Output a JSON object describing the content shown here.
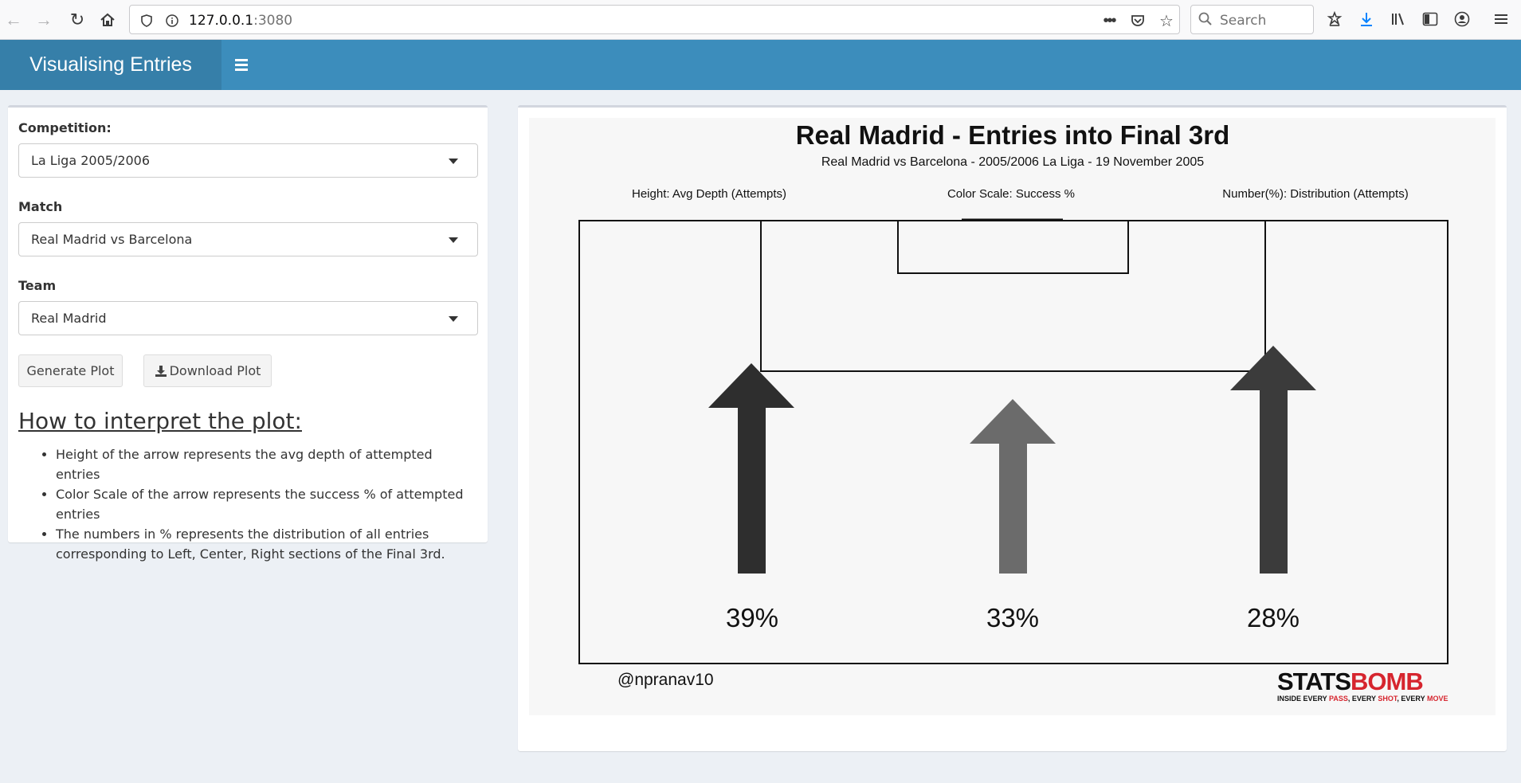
{
  "browser": {
    "url_host": "127.0.0.1",
    "url_port": ":3080",
    "search_placeholder": "Search"
  },
  "header": {
    "title": "Visualising Entries"
  },
  "sidebar": {
    "competition_label": "Competition:",
    "competition_value": "La Liga 2005/2006",
    "match_label": "Match",
    "match_value": "Real Madrid vs Barcelona",
    "team_label": "Team",
    "team_value": "Real Madrid",
    "generate_label": "Generate Plot",
    "download_label": "Download Plot",
    "interp_title": "How to interpret the plot:",
    "interp_items": [
      "Height of the arrow represents the avg depth of attempted entries",
      "Color Scale of the arrow represents the success % of attempted entries",
      "The numbers in % represents the distribution of all entries corresponding to Left, Center, Right sections of the Final 3rd."
    ]
  },
  "plot": {
    "title": "Real Madrid - Entries into Final 3rd",
    "subtitle": "Real Madrid vs Barcelona  -  2005/2006 La Liga  -  19 November 2005",
    "legend_height": "Height: Avg Depth (Attempts)",
    "legend_color": "Color Scale: Success %",
    "legend_number": "Number(%): Distribution (Attempts)",
    "credit": "@npranav10",
    "logo_text_a": "STATS",
    "logo_text_b": "BOMB",
    "logo_tagline_1": "INSIDE EVERY ",
    "logo_tagline_2": "PASS",
    "logo_tagline_3": ", EVERY ",
    "logo_tagline_4": "SHOT",
    "logo_tagline_5": ", EVERY ",
    "logo_tagline_6": "MOVE",
    "arrows": [
      {
        "label": "39%",
        "color": "#2e2e2e"
      },
      {
        "label": "33%",
        "color": "#6b6b6b"
      },
      {
        "label": "28%",
        "color": "#3b3b3b"
      }
    ]
  }
}
